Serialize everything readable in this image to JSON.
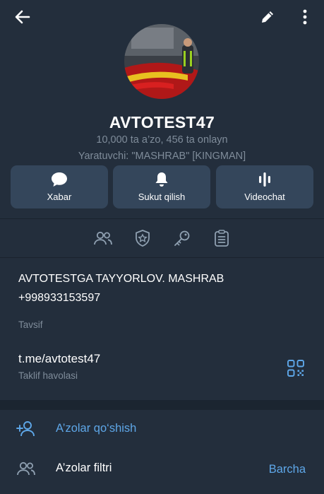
{
  "header": {
    "back_icon": "arrow-left-icon",
    "edit_icon": "pencil-icon",
    "more_icon": "more-vertical-icon"
  },
  "profile": {
    "title": "AVTOTEST47",
    "members_line": "10,000 ta a’zo, 456 ta onlayn",
    "creator_line": "Yaratuvchi: \"MASHRAB\" [KINGMAN]"
  },
  "actions": [
    {
      "label": "Xabar",
      "icon": "message-icon"
    },
    {
      "label": "Sukut qilish",
      "icon": "bell-icon"
    },
    {
      "label": "Videochat",
      "icon": "voice-wave-icon"
    }
  ],
  "tabs": [
    {
      "icon": "members-icon"
    },
    {
      "icon": "shield-star-icon"
    },
    {
      "icon": "key-icon"
    },
    {
      "icon": "clipboard-icon"
    }
  ],
  "info": {
    "description_line1": "AVTOTESTGA TAYYORLOV. MASHRAB",
    "description_line2": "+998933153597",
    "description_caption": "Tavsif",
    "link": "t.me/avtotest47",
    "link_caption": "Taklif havolasi",
    "qr_icon": "qr-code-icon"
  },
  "members_section": {
    "add_label": "A’zolar qo‘shish",
    "filter_label": "A’zolar filtri",
    "filter_value": "Barcha"
  },
  "colors": {
    "background": "#232e3c",
    "button": "#34465b",
    "accent": "#5ea7e8",
    "muted": "#7f8c9a"
  }
}
